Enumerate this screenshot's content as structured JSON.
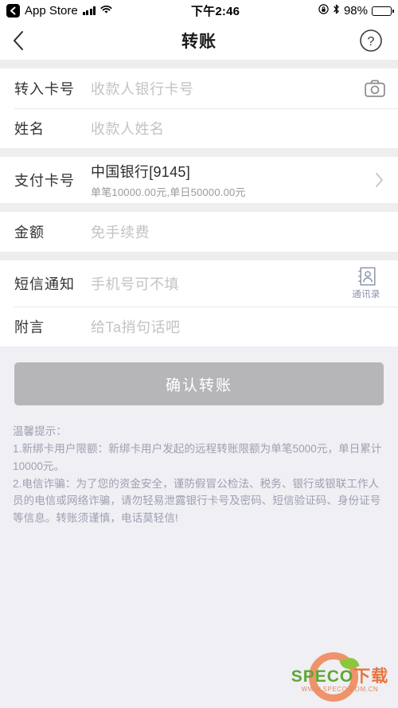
{
  "status_bar": {
    "back_app": "App Store",
    "time": "下午2:46",
    "battery_percent": "98%",
    "icons": {
      "back": "back-chevron-icon",
      "signal": "cellular-signal-icon",
      "wifi": "wifi-icon",
      "rotation_lock": "rotation-lock-icon",
      "bluetooth": "bluetooth-icon",
      "battery": "battery-icon"
    }
  },
  "navbar": {
    "title": "转账",
    "back_icon": "back-chevron-icon",
    "help_icon": "question-mark-circle-icon"
  },
  "form": {
    "groups": [
      {
        "rows": [
          {
            "label": "转入卡号",
            "placeholder": "收款人银行卡号",
            "trailing_icon": "camera-icon"
          },
          {
            "label": "姓名",
            "placeholder": "收款人姓名"
          }
        ]
      },
      {
        "rows": [
          {
            "label": "支付卡号",
            "value": "中国银行[9145]",
            "sub_value": "单笔10000.00元,单日50000.00元",
            "trailing_icon": "chevron-right-icon"
          }
        ]
      },
      {
        "rows": [
          {
            "label": "金额",
            "placeholder": "免手续费"
          }
        ]
      },
      {
        "rows": [
          {
            "label": "短信通知",
            "placeholder": "手机号可不填",
            "trailing_icon": "contacts-icon",
            "trailing_label": "通讯录"
          },
          {
            "label": "附言",
            "placeholder": "给Ta捎句话吧"
          }
        ]
      }
    ]
  },
  "confirm_button": {
    "label": "确认转账",
    "enabled": false,
    "background": "#b6b6b8",
    "text_color": "#ffffff"
  },
  "tips": {
    "heading": "温馨提示：",
    "line1": "1.新绑卡用户限额：新绑卡用户发起的远程转账限额为单笔5000元，单日累计10000元。",
    "line2": "2.电信诈骗：为了您的资金安全，谨防假冒公检法、税务、银行或银联工作人员的电信或网络诈骗，请勿轻易泄露银行卡号及密码、短信验证码、身份证号等信息。转账须谨慎，电话莫轻信!"
  },
  "watermark": {
    "brand": "SPECO",
    "brand_cn": "下载",
    "url": "WWW.SPECO.COM.CN"
  },
  "colors": {
    "page_background": "#efeff4",
    "card_background": "#ffffff",
    "separator": "#eeeeee",
    "label_text": "#333333",
    "placeholder_text": "#c3c3c7",
    "tips_text": "#9ea0b0",
    "contacts_accent": "#8b93ab"
  }
}
